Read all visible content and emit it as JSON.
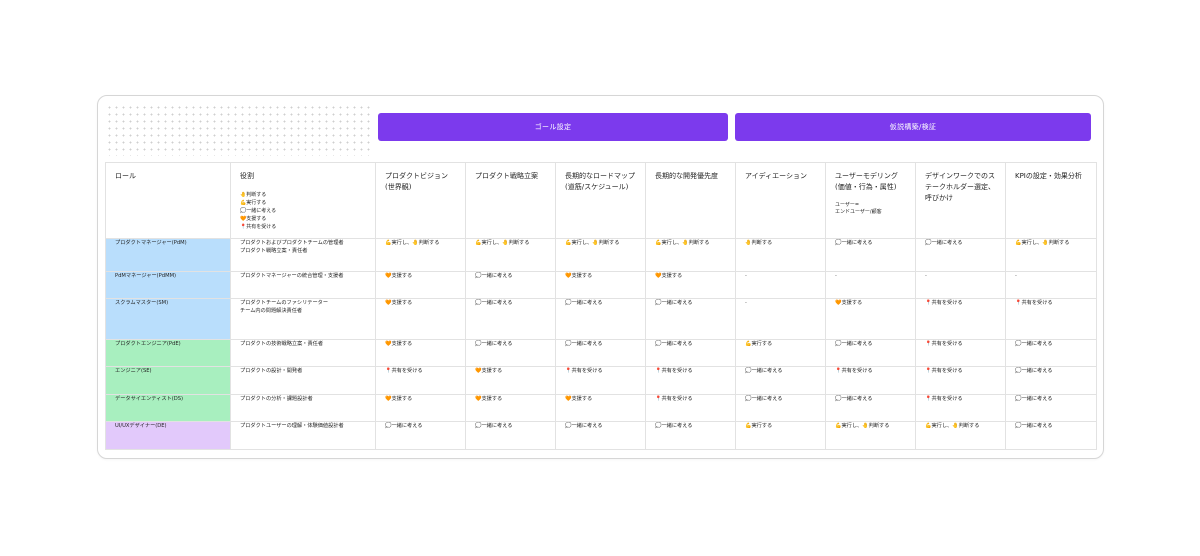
{
  "groups": {
    "goal": "ゴール設定",
    "hypothesis": "仮説構築/検証"
  },
  "header": {
    "role": "ロール",
    "yakuwari": "役割",
    "legend": [
      "🤚判断する",
      "💪実行する",
      "💭一緒に考える",
      "🧡支援する",
      "📍共有を受ける"
    ],
    "columns": [
      {
        "title": "プロダクトビジョン\n(世界観)",
        "sub": ""
      },
      {
        "title": "プロダクト戦略立案",
        "sub": ""
      },
      {
        "title": "長期的なロードマップ\n(道筋/スケジュール)",
        "sub": ""
      },
      {
        "title": "長期的な開発優先度",
        "sub": ""
      },
      {
        "title": "アイディエーション",
        "sub": ""
      },
      {
        "title": "ユーザーモデリング\n(価値・行為・属性)",
        "sub": "ユーザー=\nエンドユーザー/顧客"
      },
      {
        "title": "デザインワークでのス\nテークホルダー選定、\n呼びかけ",
        "sub": ""
      },
      {
        "title": "KPIの設定・効果分析",
        "sub": ""
      }
    ]
  },
  "rows": [
    {
      "role": "プロダクトマネージャー(PdM)",
      "color": "blue",
      "desc": "プロダクトおよびプロダクトチームの管理者\nプロダクト戦略立案・責任者",
      "cells": [
        "💪実行し、🤚判断する",
        "💪実行し、🤚判断する",
        "💪実行し、🤚判断する",
        "💪実行し、🤚判断する",
        "🤚判断する",
        "💭一緒に考える",
        "💭一緒に考える",
        "💪実行し、🤚判断する"
      ]
    },
    {
      "role": "PdMマネージャー(PdMM)",
      "color": "blue",
      "desc": "プロダクトマネージャーの統合管理・支援者",
      "cells": [
        "🧡支援する",
        "💭一緒に考える",
        "🧡支援する",
        "🧡支援する",
        "-",
        "-",
        "-",
        "-"
      ]
    },
    {
      "role": "スクラムマスター(SM)",
      "color": "blue",
      "desc": "プロダクトチームのファシリテーター\nチーム内の問題解決責任者",
      "cells": [
        "🧡支援する",
        "💭一緒に考える",
        "💭一緒に考える",
        "💭一緒に考える",
        "-",
        "🧡支援する",
        "📍共有を受ける",
        "📍共有を受ける"
      ]
    },
    {
      "role": "プロダクトエンジニア(PdE)",
      "color": "green",
      "desc": "プロダクトの技術戦略立案・責任者",
      "cells": [
        "🧡支援する",
        "💭一緒に考える",
        "💭一緒に考える",
        "💭一緒に考える",
        "💪実行する",
        "💭一緒に考える",
        "📍共有を受ける",
        "💭一緒に考える"
      ]
    },
    {
      "role": "エンジニア(SE)",
      "color": "green",
      "desc": "プロダクトの設計・開発者",
      "cells": [
        "📍共有を受ける",
        "🧡支援する",
        "📍共有を受ける",
        "📍共有を受ける",
        "💭一緒に考える",
        "📍共有を受ける",
        "📍共有を受ける",
        "💭一緒に考える"
      ]
    },
    {
      "role": "データサイエンティスト(DS)",
      "color": "green",
      "desc": "プロダクトの分析・課題設計者",
      "cells": [
        "🧡支援する",
        "🧡支援する",
        "🧡支援する",
        "📍共有を受ける",
        "💭一緒に考える",
        "💭一緒に考える",
        "📍共有を受ける",
        "💭一緒に考える"
      ]
    },
    {
      "role": "UI/UXデザイナー(DE)",
      "color": "purple",
      "desc": "プロダクトユーザーの理解・体験価値設計者",
      "cells": [
        "💭一緒に考える",
        "💭一緒に考える",
        "💭一緒に考える",
        "💭一緒に考える",
        "💪実行する",
        "💪実行し、🤚判断する",
        "💪実行し、🤚判断する",
        "💭一緒に考える"
      ]
    }
  ],
  "colors": {
    "accent": "#7c3aed",
    "blue": "#b9defc",
    "green": "#a8efbf",
    "purple": "#e2c9fb"
  }
}
